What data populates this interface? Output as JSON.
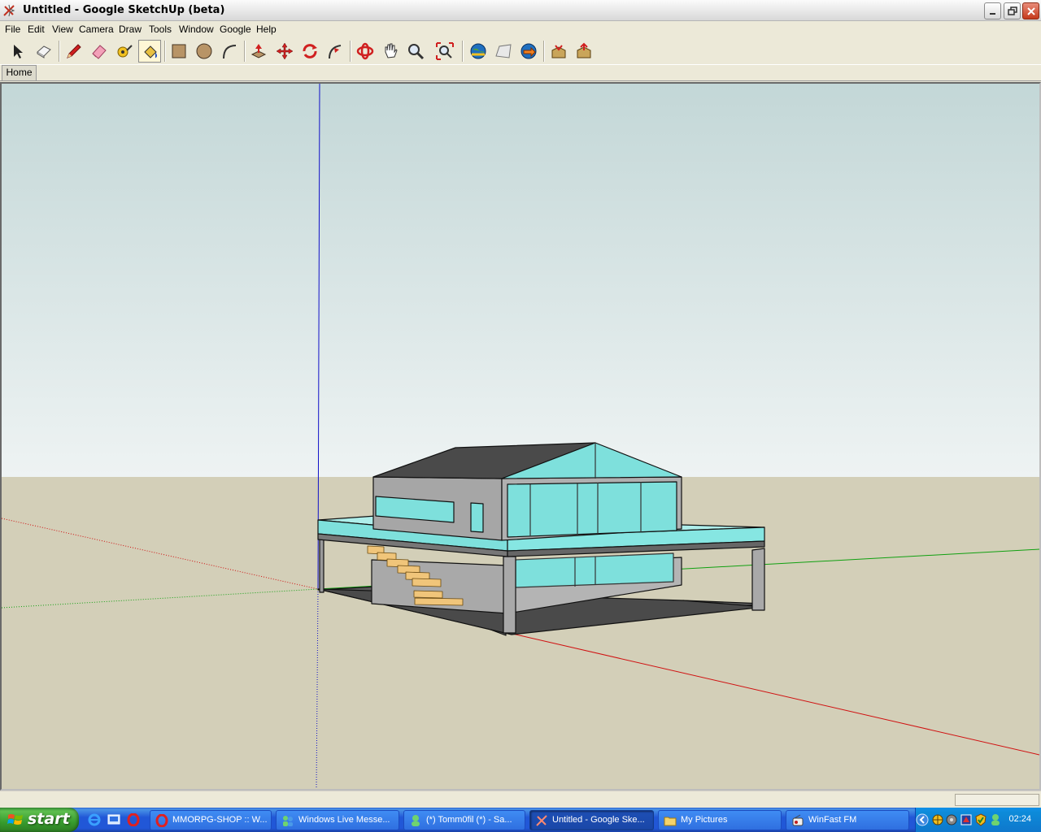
{
  "window": {
    "title": "Untitled - Google SketchUp (beta)"
  },
  "menu": [
    "File",
    "Edit",
    "View",
    "Camera",
    "Draw",
    "Tools",
    "Window",
    "Google",
    "Help"
  ],
  "toolbar": {
    "tools": [
      {
        "name": "select-tool",
        "icon": "arrow-cursor-icon",
        "active": false
      },
      {
        "name": "make-component-tool",
        "icon": "component-icon",
        "active": false
      },
      {
        "name": "line-tool",
        "icon": "pencil-icon",
        "active": false
      },
      {
        "name": "eraser-tool",
        "icon": "eraser-icon",
        "active": false
      },
      {
        "name": "tape-measure-tool",
        "icon": "tape-measure-icon",
        "active": false
      },
      {
        "name": "paint-bucket-tool",
        "icon": "paint-bucket-icon",
        "active": true
      },
      {
        "name": "rectangle-tool",
        "icon": "rectangle-icon",
        "active": false
      },
      {
        "name": "circle-tool",
        "icon": "circle-icon",
        "active": false
      },
      {
        "name": "arc-tool",
        "icon": "arc-icon",
        "active": false
      },
      {
        "name": "push-pull-tool",
        "icon": "push-pull-icon",
        "active": false
      },
      {
        "name": "move-tool",
        "icon": "move-icon",
        "active": false
      },
      {
        "name": "rotate-tool",
        "icon": "rotate-icon",
        "active": false
      },
      {
        "name": "follow-me-tool",
        "icon": "follow-me-icon",
        "active": false
      },
      {
        "name": "orbit-tool",
        "icon": "orbit-icon",
        "active": false
      },
      {
        "name": "pan-tool",
        "icon": "hand-icon",
        "active": false
      },
      {
        "name": "zoom-tool",
        "icon": "magnifier-icon",
        "active": false
      },
      {
        "name": "zoom-extents-tool",
        "icon": "zoom-extents-icon",
        "active": false
      },
      {
        "name": "get-current-view-tool",
        "icon": "globe-view-icon",
        "active": false
      },
      {
        "name": "toggle-terrain-tool",
        "icon": "terrain-icon",
        "active": false
      },
      {
        "name": "place-model-tool",
        "icon": "globe-place-icon",
        "active": false
      },
      {
        "name": "get-models-tool",
        "icon": "warehouse-get-icon",
        "active": false
      },
      {
        "name": "share-model-tool",
        "icon": "warehouse-share-icon",
        "active": false
      }
    ]
  },
  "scenes": {
    "home_label": "Home"
  },
  "colors": {
    "sky_top": "#c3d7d7",
    "sky_bottom": "#eef3f3",
    "ground": "#d3cfb8",
    "glass": "#7ee0dc",
    "wall": "#a8a8a8",
    "roof": "#4a4a4a",
    "stairs": "#f0c57a",
    "axis_red": "#d01010",
    "axis_green": "#10a010",
    "axis_blue": "#1010c8"
  },
  "taskbar": {
    "start_label": "start",
    "quick_launch": [
      "ie-icon",
      "show-desktop-icon",
      "opera-icon"
    ],
    "tasks": [
      {
        "label": "MMORPG-SHOP :: W...",
        "icon": "opera-icon",
        "active": false
      },
      {
        "label": "Windows Live Messe...",
        "icon": "messenger-icon",
        "active": false
      },
      {
        "label": "(*) Tomm0fil (*) - Sa...",
        "icon": "chat-icon",
        "active": false
      },
      {
        "label": "Untitled - Google Ske...",
        "icon": "sketchup-icon",
        "active": true
      },
      {
        "label": "My Pictures",
        "icon": "folder-icon",
        "active": false
      },
      {
        "label": "WinFast FM",
        "icon": "radio-icon",
        "active": false
      }
    ],
    "clock": "02:24"
  }
}
